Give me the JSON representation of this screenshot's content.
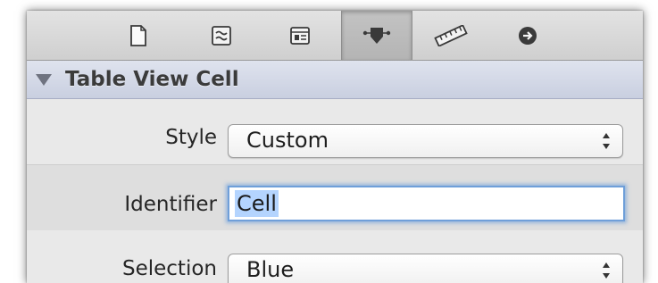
{
  "toolbar": {
    "buttons": [
      {
        "name": "file-inspector-icon"
      },
      {
        "name": "quick-help-icon"
      },
      {
        "name": "identity-inspector-icon"
      },
      {
        "name": "attributes-inspector-icon",
        "selected": true
      },
      {
        "name": "size-inspector-icon"
      },
      {
        "name": "connections-inspector-icon"
      }
    ]
  },
  "section": {
    "title": "Table View Cell",
    "expanded": true
  },
  "fields": {
    "style_label": "Style",
    "style_value": "Custom",
    "identifier_label": "Identifier",
    "identifier_value": "Cell",
    "selection_label": "Selection",
    "selection_value": "Blue"
  },
  "colors": {
    "focus_ring": "#6f9fd9",
    "text_selection": "#b4d4fe",
    "section_header": "#c9cfe0"
  }
}
